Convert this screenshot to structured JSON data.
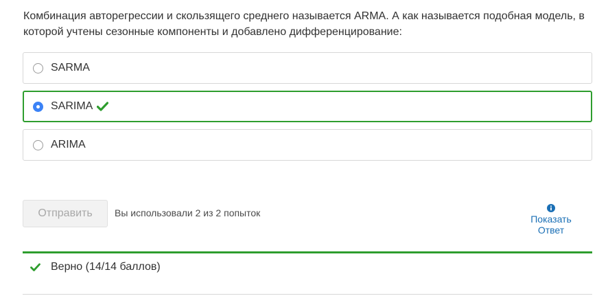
{
  "question": {
    "text": "Комбинация авторегрессии и скользящего среднего называется ARMA. А как называется подобная модель, в которой учтены сезонные компоненты и добавлено дифференцирование:"
  },
  "options": [
    {
      "label": "SARMA",
      "selected": false,
      "correct": false
    },
    {
      "label": "SARIMA",
      "selected": true,
      "correct": true
    },
    {
      "label": "ARIMA",
      "selected": false,
      "correct": false
    }
  ],
  "actions": {
    "submit_label": "Отправить",
    "attempts_text": "Вы использовали 2 из 2 попыток",
    "show_answer_line1": "Показать",
    "show_answer_line2": "Ответ"
  },
  "result": {
    "text": "Верно (14/14 баллов)"
  },
  "colors": {
    "correct": "#2e9d2e",
    "radio_selected": "#3b82f6",
    "link": "#1a6fb5"
  },
  "icons": {
    "correct": "check-icon",
    "info": "info-icon"
  }
}
